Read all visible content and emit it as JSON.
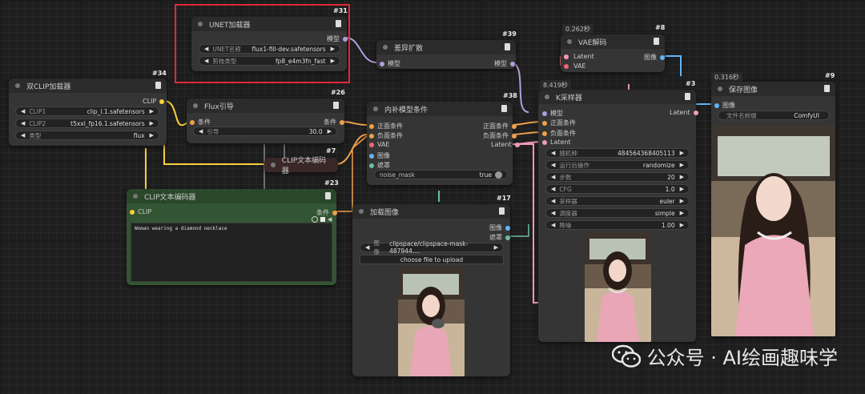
{
  "nodes": {
    "unet": {
      "id": "#31",
      "title": "UNET加载器",
      "output": "模型",
      "w1_label": "UNET名称",
      "w1_value": "flux1-fill-dev.safetensors",
      "w2_label": "剪枝类型",
      "w2_value": "fp8_e4m3fn_fast"
    },
    "diff": {
      "id": "#39",
      "title": "差异扩散",
      "input": "模型",
      "output": "模型"
    },
    "vaedec": {
      "id": "#8",
      "timer": "0.262秒",
      "title": "VAE解码",
      "in1": "Latent",
      "in2": "VAE",
      "output": "图像"
    },
    "dualclip": {
      "id": "#34",
      "title": "双CLIP加载器",
      "output": "CLIP",
      "w1_label": "CLIP1",
      "w1_value": "clip_l.1.safetensors",
      "w2_label": "CLIP2",
      "w2_value": "t5xxl_fp16.1.safetensors",
      "w3_label": "类型",
      "w3_value": "flux"
    },
    "flux": {
      "id": "#26",
      "title": "Flux引导",
      "input": "条件",
      "output": "条件",
      "w1_label": "引导",
      "w1_value": "30.0"
    },
    "inpaint": {
      "id": "#38",
      "title": "内补模型条件",
      "in1": "正面条件",
      "in2": "负面条件",
      "in3": "VAE",
      "in4": "图像",
      "in5": "遮罩",
      "out1": "正面条件",
      "out2": "负面条件",
      "out3": "Latent",
      "toggle_label": "noise_mask",
      "toggle_value": "true"
    },
    "clipenc7": {
      "id": "#7",
      "title": "CLIP文本编码器"
    },
    "clipenc23": {
      "id": "#23",
      "title": "CLIP文本编码器",
      "input": "CLIP",
      "output": "条件",
      "text": "Woman wearing a diamond necklace"
    },
    "loadimg": {
      "id": "#17",
      "title": "加载图像",
      "out1": "图像",
      "out2": "遮罩",
      "w1_label": "图像",
      "w1_value": "clipspace/clipspace-mask-487944....",
      "button": "choose file to upload"
    },
    "ksampler": {
      "id": "#3",
      "timer": "8.419秒",
      "title": "K采样器",
      "in1": "模型",
      "in2": "正面条件",
      "in3": "负面条件",
      "in4": "Latent",
      "output": "Latent",
      "widgets": [
        {
          "label": "随机种",
          "value": "484564368405113"
        },
        {
          "label": "运行后操作",
          "value": "randomize"
        },
        {
          "label": "步数",
          "value": "20"
        },
        {
          "label": "CFG",
          "value": "1.0"
        },
        {
          "label": "采样器",
          "value": "euler"
        },
        {
          "label": "调度器",
          "value": "simple"
        },
        {
          "label": "降噪",
          "value": "1.00"
        }
      ]
    },
    "save": {
      "id": "#9",
      "timer": "0.316秒",
      "title": "保存图像",
      "input": "图像",
      "w1_label": "文件名前缀",
      "w1_value": "ComfyUI"
    }
  },
  "watermark": "公众号 · AI绘画趣味学",
  "colors": {
    "model": "#b39ddb",
    "clip": "#f7d03c",
    "cond": "#f0a04b",
    "latent": "#f39ab8",
    "vae": "#f06575",
    "image": "#64b5f6",
    "mask": "#6cc0a0"
  }
}
